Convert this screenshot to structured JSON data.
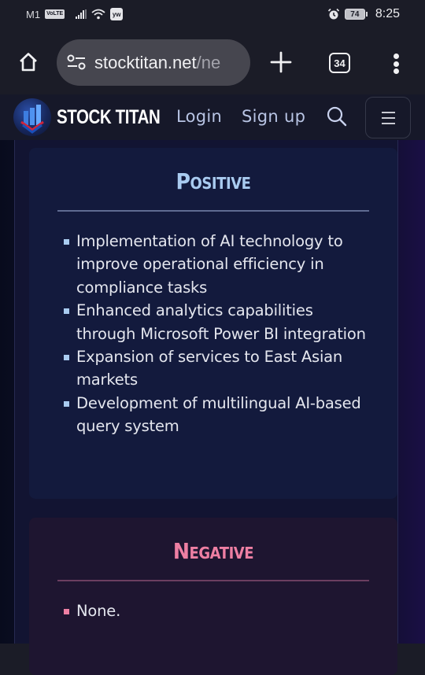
{
  "status_bar": {
    "carrier": "M1",
    "volte_badge": "VoLTE",
    "app_badge": "yw",
    "battery_level": "74",
    "time": "8:25"
  },
  "browser": {
    "url_main": "stocktitan.net",
    "url_rest": "/ne",
    "tab_count": "34",
    "icons": {
      "home": "home-icon",
      "site_settings": "tune-icon",
      "new_tab": "plus-icon",
      "tabs": "tab-switcher-icon",
      "menu": "more-vert-icon"
    }
  },
  "site_header": {
    "logo_text": "STOCK TITAN",
    "login_label": "Login",
    "signup_label": "Sign up",
    "icons": {
      "search": "search-icon",
      "menu": "hamburger-icon"
    }
  },
  "positive": {
    "title": "Positive",
    "accent_color": "#a9cbf0",
    "items": [
      "Implementation of AI technology to improve operational efficiency in compliance tasks",
      "Enhanced analytics capabilities through Microsoft Power BI integration",
      "Expansion of services to East Asian markets",
      "Development of multilingual AI-based query system"
    ]
  },
  "negative": {
    "title": "Negative",
    "accent_color": "#ee7fa3",
    "items": [
      "None."
    ]
  }
}
